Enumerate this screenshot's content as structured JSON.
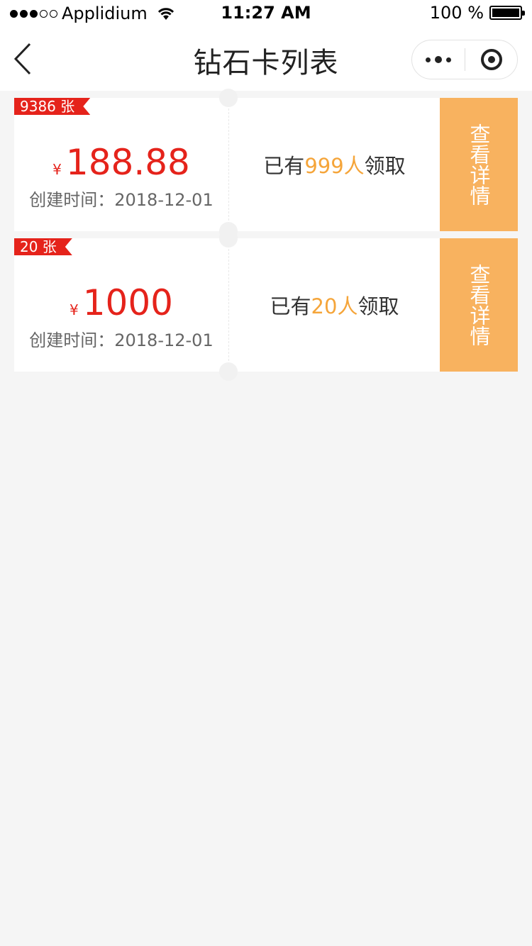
{
  "status_bar": {
    "carrier": "Applidium",
    "time": "11:27 AM",
    "battery": "100 %"
  },
  "nav": {
    "title": "钻石卡列表",
    "back_icon": "chevron-left-icon",
    "more_icon": "more-dots-icon",
    "close_icon": "target-close-icon"
  },
  "cards": [
    {
      "count_label": "9386 张",
      "currency_symbol": "¥",
      "amount": "188.88",
      "created_label": "创建时间：2018-12-01",
      "received_prefix": "已有",
      "received_count": "999人",
      "received_suffix": "领取",
      "detail_label": "查看详情"
    },
    {
      "count_label": "20 张",
      "currency_symbol": "¥",
      "amount": "1000",
      "created_label": "创建时间：2018-12-01",
      "received_prefix": "已有",
      "received_count": "20人",
      "received_suffix": "领取",
      "detail_label": "查看详情"
    }
  ],
  "colors": {
    "accent_red": "#e5231b",
    "accent_orange": "#f8b25f",
    "highlight_orange": "#f5a53a",
    "background": "#f5f5f5"
  }
}
